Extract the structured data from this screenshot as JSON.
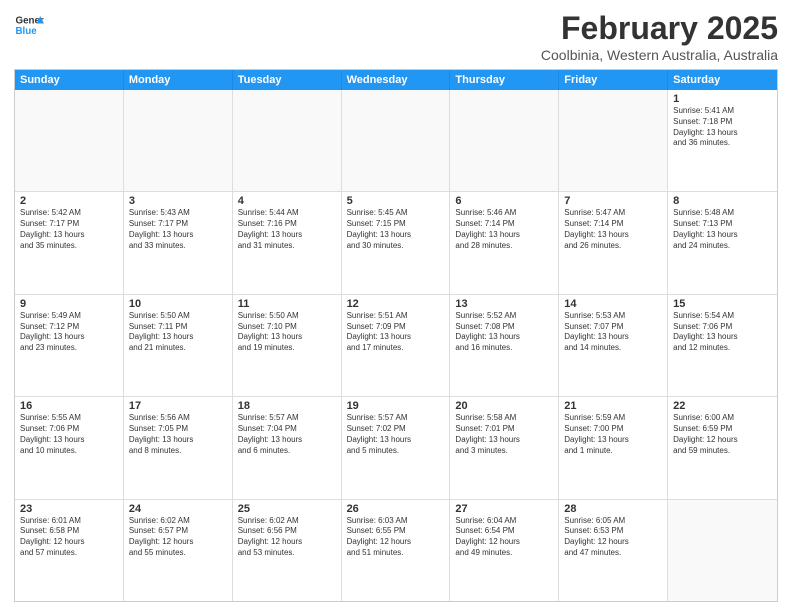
{
  "app": {
    "logo_line1": "General",
    "logo_line2": "Blue"
  },
  "header": {
    "title": "February 2025",
    "subtitle": "Coolbinia, Western Australia, Australia"
  },
  "calendar": {
    "days": [
      "Sunday",
      "Monday",
      "Tuesday",
      "Wednesday",
      "Thursday",
      "Friday",
      "Saturday"
    ],
    "rows": [
      [
        {
          "day": "",
          "text": "",
          "empty": true
        },
        {
          "day": "",
          "text": "",
          "empty": true
        },
        {
          "day": "",
          "text": "",
          "empty": true
        },
        {
          "day": "",
          "text": "",
          "empty": true
        },
        {
          "day": "",
          "text": "",
          "empty": true
        },
        {
          "day": "",
          "text": "",
          "empty": true
        },
        {
          "day": "1",
          "text": "Sunrise: 5:41 AM\nSunset: 7:18 PM\nDaylight: 13 hours\nand 36 minutes.",
          "empty": false
        }
      ],
      [
        {
          "day": "2",
          "text": "Sunrise: 5:42 AM\nSunset: 7:17 PM\nDaylight: 13 hours\nand 35 minutes.",
          "empty": false
        },
        {
          "day": "3",
          "text": "Sunrise: 5:43 AM\nSunset: 7:17 PM\nDaylight: 13 hours\nand 33 minutes.",
          "empty": false
        },
        {
          "day": "4",
          "text": "Sunrise: 5:44 AM\nSunset: 7:16 PM\nDaylight: 13 hours\nand 31 minutes.",
          "empty": false
        },
        {
          "day": "5",
          "text": "Sunrise: 5:45 AM\nSunset: 7:15 PM\nDaylight: 13 hours\nand 30 minutes.",
          "empty": false
        },
        {
          "day": "6",
          "text": "Sunrise: 5:46 AM\nSunset: 7:14 PM\nDaylight: 13 hours\nand 28 minutes.",
          "empty": false
        },
        {
          "day": "7",
          "text": "Sunrise: 5:47 AM\nSunset: 7:14 PM\nDaylight: 13 hours\nand 26 minutes.",
          "empty": false
        },
        {
          "day": "8",
          "text": "Sunrise: 5:48 AM\nSunset: 7:13 PM\nDaylight: 13 hours\nand 24 minutes.",
          "empty": false
        }
      ],
      [
        {
          "day": "9",
          "text": "Sunrise: 5:49 AM\nSunset: 7:12 PM\nDaylight: 13 hours\nand 23 minutes.",
          "empty": false
        },
        {
          "day": "10",
          "text": "Sunrise: 5:50 AM\nSunset: 7:11 PM\nDaylight: 13 hours\nand 21 minutes.",
          "empty": false
        },
        {
          "day": "11",
          "text": "Sunrise: 5:50 AM\nSunset: 7:10 PM\nDaylight: 13 hours\nand 19 minutes.",
          "empty": false
        },
        {
          "day": "12",
          "text": "Sunrise: 5:51 AM\nSunset: 7:09 PM\nDaylight: 13 hours\nand 17 minutes.",
          "empty": false
        },
        {
          "day": "13",
          "text": "Sunrise: 5:52 AM\nSunset: 7:08 PM\nDaylight: 13 hours\nand 16 minutes.",
          "empty": false
        },
        {
          "day": "14",
          "text": "Sunrise: 5:53 AM\nSunset: 7:07 PM\nDaylight: 13 hours\nand 14 minutes.",
          "empty": false
        },
        {
          "day": "15",
          "text": "Sunrise: 5:54 AM\nSunset: 7:06 PM\nDaylight: 13 hours\nand 12 minutes.",
          "empty": false
        }
      ],
      [
        {
          "day": "16",
          "text": "Sunrise: 5:55 AM\nSunset: 7:06 PM\nDaylight: 13 hours\nand 10 minutes.",
          "empty": false
        },
        {
          "day": "17",
          "text": "Sunrise: 5:56 AM\nSunset: 7:05 PM\nDaylight: 13 hours\nand 8 minutes.",
          "empty": false
        },
        {
          "day": "18",
          "text": "Sunrise: 5:57 AM\nSunset: 7:04 PM\nDaylight: 13 hours\nand 6 minutes.",
          "empty": false
        },
        {
          "day": "19",
          "text": "Sunrise: 5:57 AM\nSunset: 7:02 PM\nDaylight: 13 hours\nand 5 minutes.",
          "empty": false
        },
        {
          "day": "20",
          "text": "Sunrise: 5:58 AM\nSunset: 7:01 PM\nDaylight: 13 hours\nand 3 minutes.",
          "empty": false
        },
        {
          "day": "21",
          "text": "Sunrise: 5:59 AM\nSunset: 7:00 PM\nDaylight: 13 hours\nand 1 minute.",
          "empty": false
        },
        {
          "day": "22",
          "text": "Sunrise: 6:00 AM\nSunset: 6:59 PM\nDaylight: 12 hours\nand 59 minutes.",
          "empty": false
        }
      ],
      [
        {
          "day": "23",
          "text": "Sunrise: 6:01 AM\nSunset: 6:58 PM\nDaylight: 12 hours\nand 57 minutes.",
          "empty": false
        },
        {
          "day": "24",
          "text": "Sunrise: 6:02 AM\nSunset: 6:57 PM\nDaylight: 12 hours\nand 55 minutes.",
          "empty": false
        },
        {
          "day": "25",
          "text": "Sunrise: 6:02 AM\nSunset: 6:56 PM\nDaylight: 12 hours\nand 53 minutes.",
          "empty": false
        },
        {
          "day": "26",
          "text": "Sunrise: 6:03 AM\nSunset: 6:55 PM\nDaylight: 12 hours\nand 51 minutes.",
          "empty": false
        },
        {
          "day": "27",
          "text": "Sunrise: 6:04 AM\nSunset: 6:54 PM\nDaylight: 12 hours\nand 49 minutes.",
          "empty": false
        },
        {
          "day": "28",
          "text": "Sunrise: 6:05 AM\nSunset: 6:53 PM\nDaylight: 12 hours\nand 47 minutes.",
          "empty": false
        },
        {
          "day": "",
          "text": "",
          "empty": true
        }
      ]
    ]
  }
}
